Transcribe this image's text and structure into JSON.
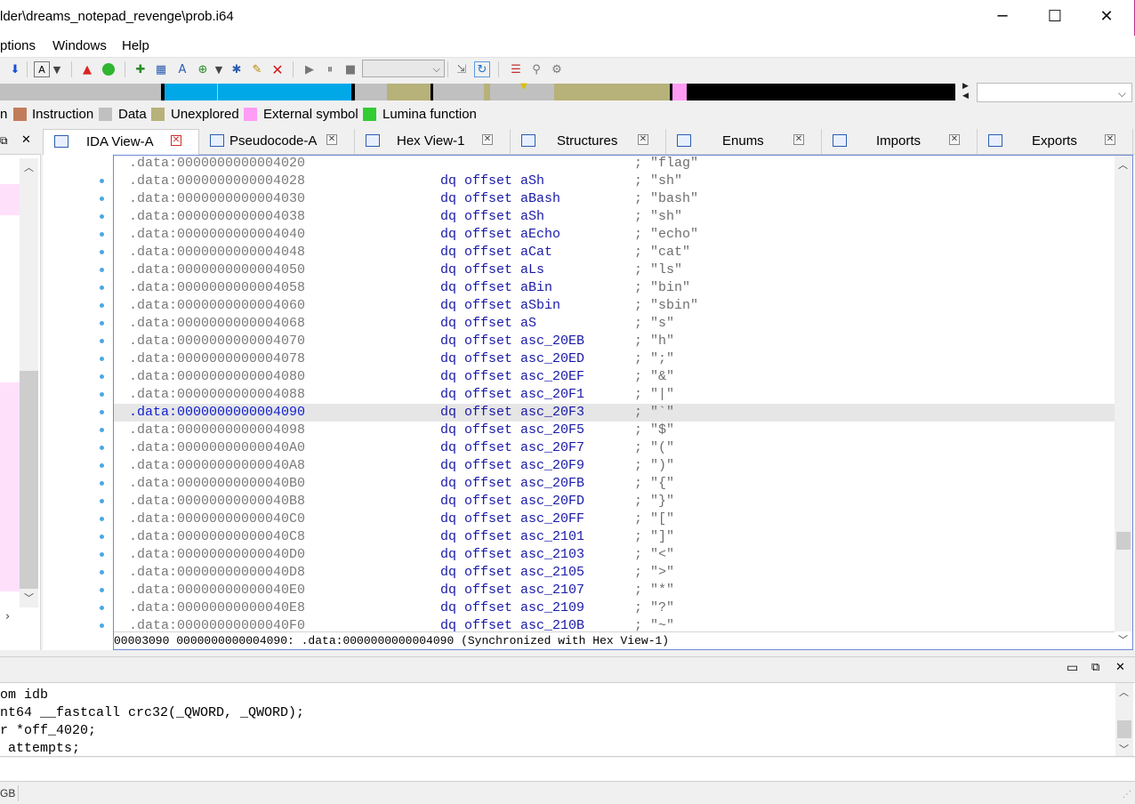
{
  "window": {
    "title": "lder\\dreams_notepad_revenge\\prob.i64",
    "minimize": "─",
    "maximize": "☐",
    "close": "✕"
  },
  "menu": [
    "ptions",
    "Windows",
    "Help"
  ],
  "legend": [
    {
      "label": "n",
      "color": null
    },
    {
      "label": "Instruction",
      "color": "#c27b5a"
    },
    {
      "label": "Data",
      "color": "#c0c0c0"
    },
    {
      "label": "Unexplored",
      "color": "#b7b17a"
    },
    {
      "label": "External symbol",
      "color": "#ff9cf4"
    },
    {
      "label": "Lumina function",
      "color": "#33cc33"
    }
  ],
  "tabs": [
    {
      "label": "IDA View-A",
      "active": true
    },
    {
      "label": "Pseudocode-A",
      "active": false
    },
    {
      "label": "Hex View-1",
      "active": false
    },
    {
      "label": "Structures",
      "active": false
    },
    {
      "label": "Enums",
      "active": false
    },
    {
      "label": "Imports",
      "active": false
    },
    {
      "label": "Exports",
      "active": false
    }
  ],
  "listing": [
    {
      "addr": ".data:0000000000004020",
      "ins": "",
      "com": "; \"flag\"",
      "dot": false
    },
    {
      "addr": ".data:0000000000004028",
      "ins": "dq offset aSh",
      "com": "; \"sh\"",
      "dot": true
    },
    {
      "addr": ".data:0000000000004030",
      "ins": "dq offset aBash",
      "com": "; \"bash\"",
      "dot": true
    },
    {
      "addr": ".data:0000000000004038",
      "ins": "dq offset aSh",
      "com": "; \"sh\"",
      "dot": true
    },
    {
      "addr": ".data:0000000000004040",
      "ins": "dq offset aEcho",
      "com": "; \"echo\"",
      "dot": true
    },
    {
      "addr": ".data:0000000000004048",
      "ins": "dq offset aCat",
      "com": "; \"cat\"",
      "dot": true
    },
    {
      "addr": ".data:0000000000004050",
      "ins": "dq offset aLs",
      "com": "; \"ls\"",
      "dot": true
    },
    {
      "addr": ".data:0000000000004058",
      "ins": "dq offset aBin",
      "com": "; \"bin\"",
      "dot": true
    },
    {
      "addr": ".data:0000000000004060",
      "ins": "dq offset aSbin",
      "com": "; \"sbin\"",
      "dot": true
    },
    {
      "addr": ".data:0000000000004068",
      "ins": "dq offset aS",
      "com": "; \"s\"",
      "dot": true
    },
    {
      "addr": ".data:0000000000004070",
      "ins": "dq offset asc_20EB",
      "com": "; \"h\"",
      "dot": true
    },
    {
      "addr": ".data:0000000000004078",
      "ins": "dq offset asc_20ED",
      "com": "; \";\"",
      "dot": true
    },
    {
      "addr": ".data:0000000000004080",
      "ins": "dq offset asc_20EF",
      "com": "; \"&\"",
      "dot": true
    },
    {
      "addr": ".data:0000000000004088",
      "ins": "dq offset asc_20F1",
      "com": "; \"|\"",
      "dot": true
    },
    {
      "addr": ".data:0000000000004090",
      "ins": "dq offset asc_20F3",
      "com": "; \"`\"",
      "dot": true,
      "selected": true
    },
    {
      "addr": ".data:0000000000004098",
      "ins": "dq offset asc_20F5",
      "com": "; \"$\"",
      "dot": true
    },
    {
      "addr": ".data:00000000000040A0",
      "ins": "dq offset asc_20F7",
      "com": "; \"(\"",
      "dot": true
    },
    {
      "addr": ".data:00000000000040A8",
      "ins": "dq offset asc_20F9",
      "com": "; \")\"",
      "dot": true
    },
    {
      "addr": ".data:00000000000040B0",
      "ins": "dq offset asc_20FB",
      "com": "; \"{\"",
      "dot": true
    },
    {
      "addr": ".data:00000000000040B8",
      "ins": "dq offset asc_20FD",
      "com": "; \"}\"",
      "dot": true
    },
    {
      "addr": ".data:00000000000040C0",
      "ins": "dq offset asc_20FF",
      "com": "; \"[\"",
      "dot": true
    },
    {
      "addr": ".data:00000000000040C8",
      "ins": "dq offset asc_2101",
      "com": "; \"]\"",
      "dot": true
    },
    {
      "addr": ".data:00000000000040D0",
      "ins": "dq offset asc_2103",
      "com": "; \"<\"",
      "dot": true
    },
    {
      "addr": ".data:00000000000040D8",
      "ins": "dq offset asc_2105",
      "com": "; \">\"",
      "dot": true
    },
    {
      "addr": ".data:00000000000040E0",
      "ins": "dq offset asc_2107",
      "com": "; \"*\"",
      "dot": true
    },
    {
      "addr": ".data:00000000000040E8",
      "ins": "dq offset asc_2109",
      "com": "; \"?\"",
      "dot": true
    },
    {
      "addr": ".data:00000000000040F0",
      "ins": "dq offset asc_210B",
      "com": "; \"~\"",
      "dot": true
    }
  ],
  "listing_status": "00003090 0000000000004090: .data:0000000000004090 (Synchronized with Hex View-1)",
  "output_lines": [
    "om idb",
    "nt64 __fastcall crc32(_QWORD, _QWORD);",
    "r *off_4020;",
    " attempts;"
  ],
  "bottom_status": "GB",
  "colors": {
    "selected_addr": "#0f1fd0",
    "instruction_text": "#1a1aa8",
    "comment_text": "#6e6e6e",
    "nav_blue": "#00a8e8",
    "nav_olive": "#b7b17a",
    "nav_pink": "#ff9cf4"
  }
}
